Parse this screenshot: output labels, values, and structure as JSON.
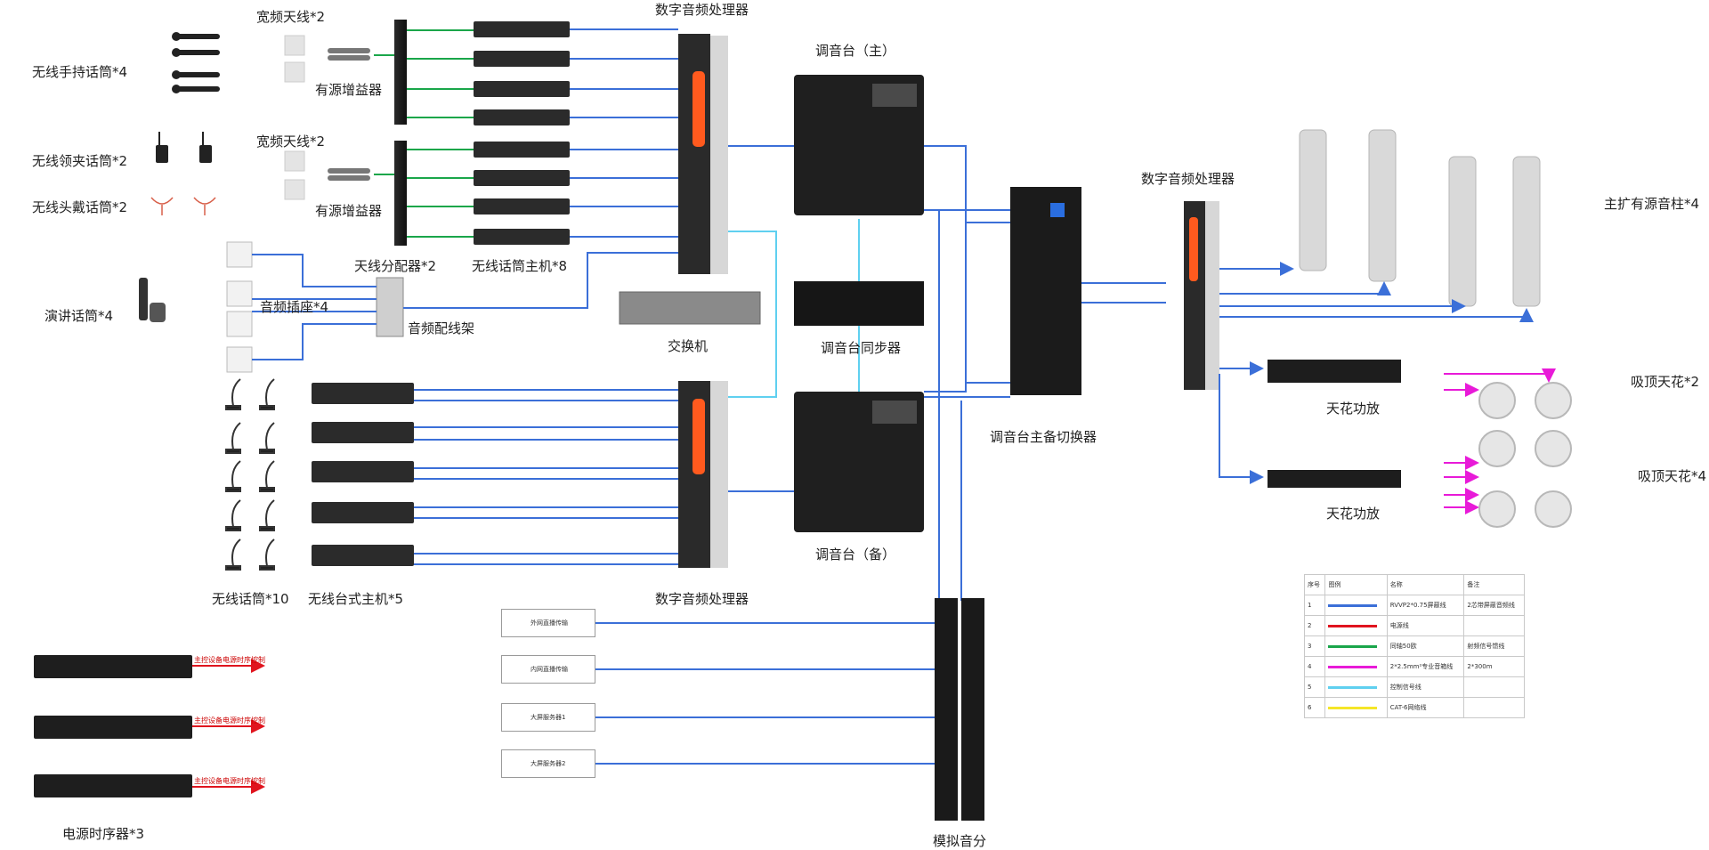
{
  "labels": {
    "wireless_handheld": "无线手持话筒*4",
    "wireless_lavalier": "无线领夹话筒*2",
    "wireless_headset": "无线头戴话筒*2",
    "speech_mic": "演讲话筒*4",
    "wideband_antenna_1": "宽频天线*2",
    "wideband_antenna_2": "宽频天线*2",
    "active_booster_1": "有源增益器",
    "active_booster_2": "有源增益器",
    "antenna_splitter": "天线分配器*2",
    "wireless_receiver": "无线话筒主机*8",
    "audio_socket": "音频插座*4",
    "audio_patch": "音频配线架",
    "dsp_top": "数字音频处理器",
    "dsp_bottom": "数字音频处理器",
    "dsp_right": "数字音频处理器",
    "mixer_main": "调音台（主）",
    "mixer_backup": "调音台（备）",
    "switch": "交换机",
    "mixer_sync": "调音台同步器",
    "mixer_switcher": "调音台主备切换器",
    "wireless_mic10": "无线话筒*10",
    "desk_host": "无线台式主机*5",
    "main_column": "主扩有源音柱*4",
    "ceiling_amp_1": "天花功放",
    "ceiling_amp_2": "天花功放",
    "ceiling_spk_2": "吸顶天花*2",
    "ceiling_spk_4": "吸顶天花*4",
    "analog_split": "模拟音分",
    "power_sequencer": "电源时序器*3",
    "seq_ctrl_1": "主控设备电源时序控制",
    "seq_ctrl_2": "主控设备电源时序控制",
    "seq_ctrl_3": "主控设备电源时序控制"
  },
  "output_boxes": [
    "外网直播传输",
    "内网直播传输",
    "大屏服务器1",
    "大屏服务器2"
  ],
  "legend": {
    "headers": [
      "序号",
      "图例",
      "名称",
      "备注"
    ],
    "rows": [
      {
        "no": "1",
        "color": "#3b6fd8",
        "name": "RVVP2*0.75屏蔽线",
        "note": "2芯带屏蔽音频线"
      },
      {
        "no": "2",
        "color": "#e0141e",
        "name": "电源线",
        "note": ""
      },
      {
        "no": "3",
        "color": "#1aa64a",
        "name": "同轴50欧",
        "note": "射频信号馈线"
      },
      {
        "no": "4",
        "color": "#e81ad8",
        "name": "2*2.5mm²专业音箱线",
        "note": "2*300m"
      },
      {
        "no": "5",
        "color": "#5fd0f0",
        "name": "控制信号线",
        "note": ""
      },
      {
        "no": "6",
        "color": "#f5e628",
        "name": "CAT-6网络线",
        "note": ""
      }
    ]
  },
  "colors": {
    "audio": "#3b6fd8",
    "power": "#e0141e",
    "rf": "#1aa64a",
    "speaker": "#e81ad8",
    "control": "#5fd0f0",
    "network": "#f5e628"
  }
}
